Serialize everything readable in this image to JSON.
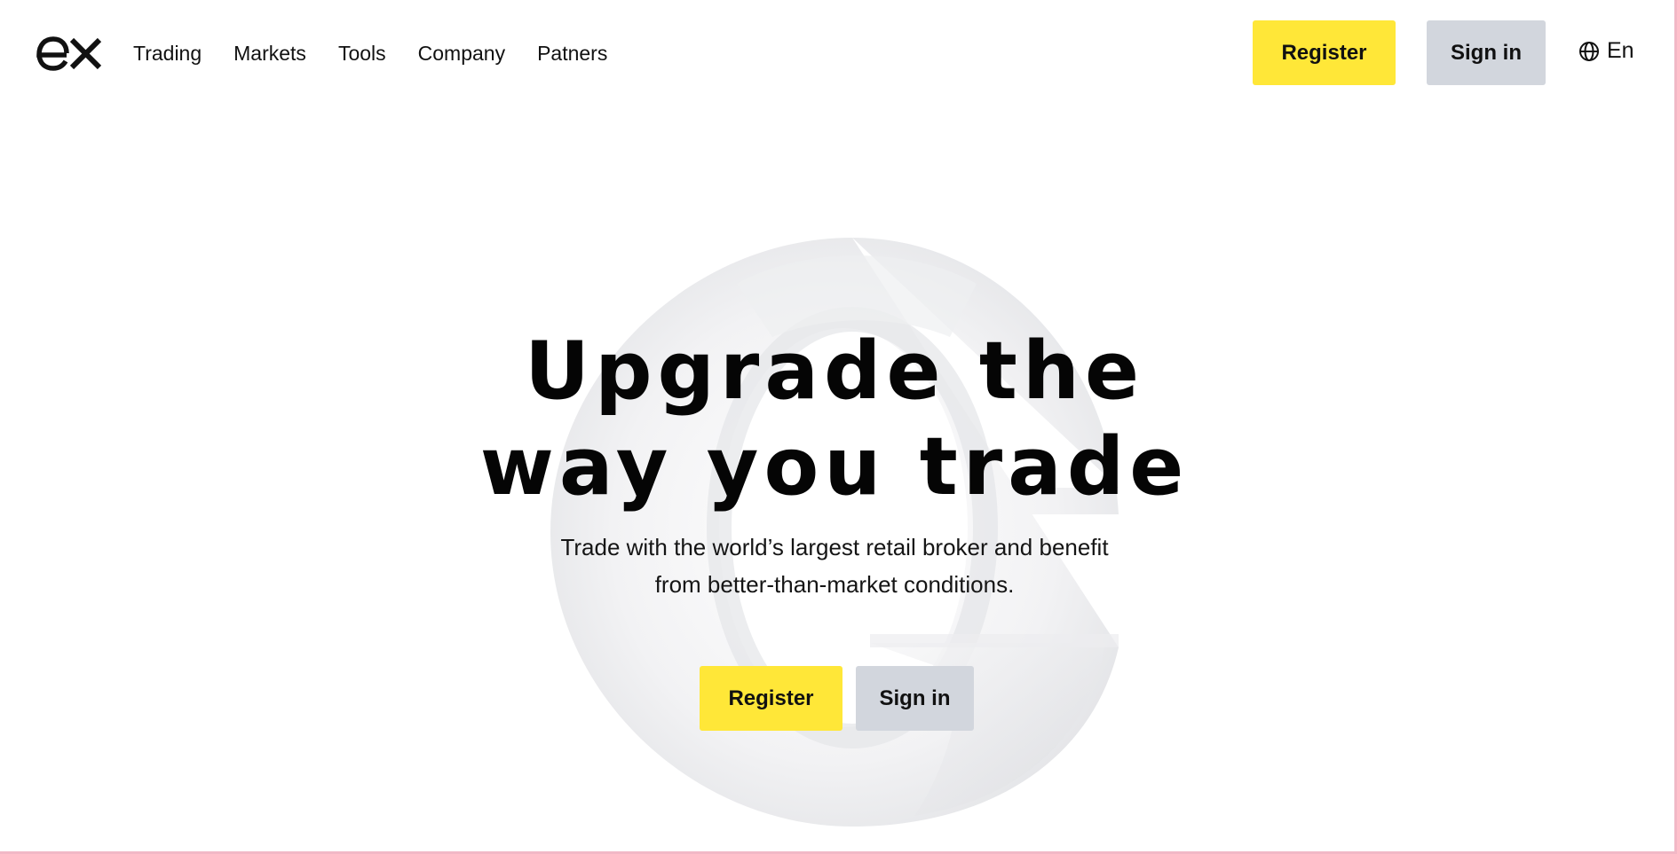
{
  "header": {
    "logo_text": "ex",
    "nav": [
      {
        "label": "Trading"
      },
      {
        "label": "Markets"
      },
      {
        "label": "Tools"
      },
      {
        "label": "Company"
      },
      {
        "label": "Patners"
      }
    ],
    "register_label": "Register",
    "signin_label": "Sign in",
    "language": {
      "icon": "globe-icon",
      "label": "En"
    }
  },
  "hero": {
    "title_line1": "Upgrade the",
    "title_line2": "way you trade",
    "subtitle_line1": "Trade with the world’s largest retail broker and benefit",
    "subtitle_line2": "from better-than-market conditions.",
    "register_label": "Register",
    "signin_label": "Sign in"
  },
  "colors": {
    "accent_yellow": "#ffe738",
    "secondary_gray": "#d2d6dd",
    "text": "#0e0e0e",
    "background": "#ffffff"
  }
}
